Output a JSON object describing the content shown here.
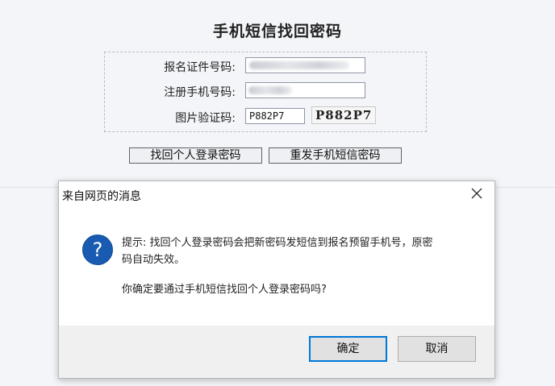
{
  "page": {
    "title": "手机短信找回密码"
  },
  "form": {
    "id_label": "报名证件号码:",
    "phone_label": "注册手机号码:",
    "captcha_label": "图片验证码:",
    "captcha_value": "P882P7",
    "captcha_image_text": "P882P7"
  },
  "buttons": {
    "retrieve": "找回个人登录密码",
    "resend": "重发手机短信密码"
  },
  "dialog": {
    "title": "来自网页的消息",
    "line1": "提示: 找回个人登录密码会把新密码发短信到报名预留手机号，原密",
    "line2": "码自动失效。",
    "question": "你确定要通过手机短信找回个人登录密码吗?",
    "ok": "确定",
    "cancel": "取消",
    "icon": "question-icon",
    "close_icon": "close-icon"
  }
}
